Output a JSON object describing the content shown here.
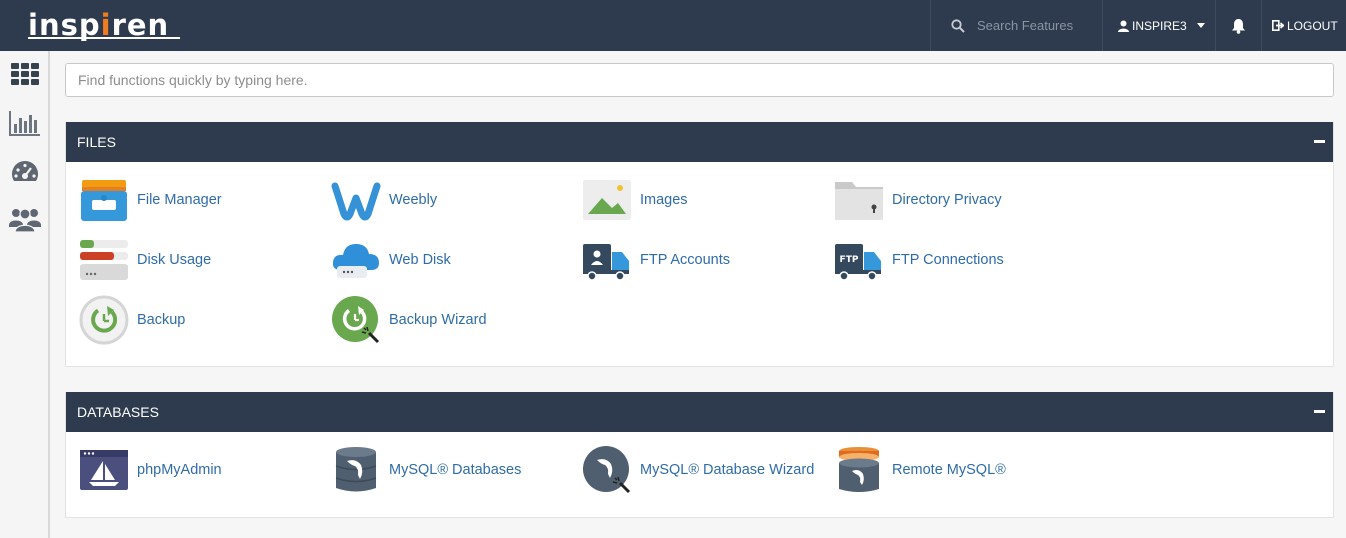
{
  "brand": {
    "logo_pre": "insp",
    "logo_accent": "i",
    "logo_post": "ren"
  },
  "topbar": {
    "search_placeholder": "Search Features",
    "username": "INSPIRE3",
    "logout_label": "LOGOUT"
  },
  "sidebar": {
    "items": [
      {
        "icon": "grid-icon"
      },
      {
        "icon": "stats-chart-icon"
      },
      {
        "icon": "dashboard-gauge-icon"
      },
      {
        "icon": "users-icon"
      }
    ]
  },
  "quickfind": {
    "placeholder": "Find functions quickly by typing here."
  },
  "files": {
    "title": "FILES",
    "items": [
      {
        "label": "File Manager",
        "icon": "file-manager-icon"
      },
      {
        "label": "Weebly",
        "icon": "weebly-icon"
      },
      {
        "label": "Images",
        "icon": "images-icon"
      },
      {
        "label": "Directory Privacy",
        "icon": "directory-privacy-icon"
      },
      {
        "label": "Disk Usage",
        "icon": "disk-usage-icon"
      },
      {
        "label": "Web Disk",
        "icon": "web-disk-icon"
      },
      {
        "label": "FTP Accounts",
        "icon": "ftp-accounts-icon"
      },
      {
        "label": "FTP Connections",
        "icon": "ftp-connections-icon"
      },
      {
        "label": "Backup",
        "icon": "backup-icon"
      },
      {
        "label": "Backup Wizard",
        "icon": "backup-wizard-icon"
      }
    ]
  },
  "databases": {
    "title": "DATABASES",
    "items": [
      {
        "label": "phpMyAdmin",
        "icon": "phpmyadmin-icon"
      },
      {
        "label": "MySQL® Databases",
        "icon": "mysql-databases-icon"
      },
      {
        "label": "MySQL® Database Wizard",
        "icon": "mysql-wizard-icon"
      },
      {
        "label": "Remote MySQL®",
        "icon": "remote-mysql-icon"
      }
    ]
  },
  "colors": {
    "navy": "#2e3b4e",
    "link": "#2f6ca8",
    "accent": "#ef7c1f"
  }
}
